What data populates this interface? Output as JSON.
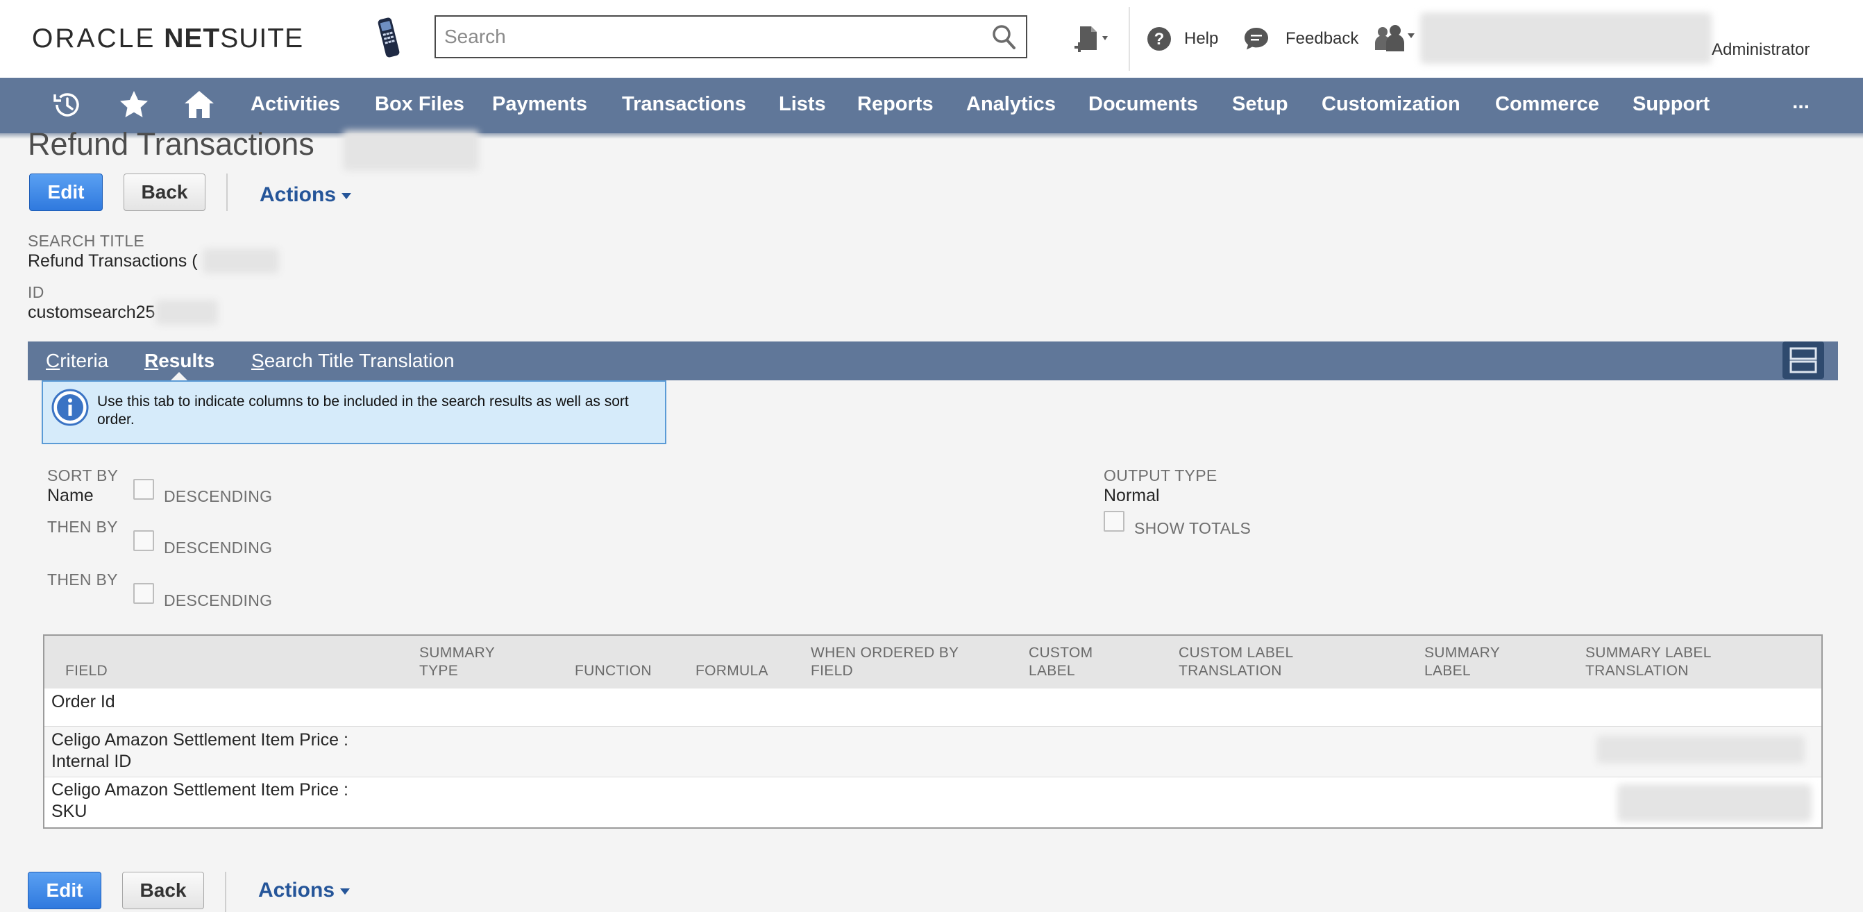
{
  "header": {
    "logo_oracle": "ORACLE",
    "logo_net": "NET",
    "logo_suite": "SUITE",
    "search_placeholder": "Search",
    "help_label": "Help",
    "feedback_label": "Feedback",
    "role_label": "Administrator"
  },
  "nav": {
    "items": [
      "Activities",
      "Box Files",
      "Payments",
      "Transactions",
      "Lists",
      "Reports",
      "Analytics",
      "Documents",
      "Setup",
      "Customization",
      "Commerce",
      "Support"
    ],
    "more": "..."
  },
  "page": {
    "title": "Refund Transactions",
    "buttons": {
      "edit": "Edit",
      "back": "Back",
      "actions": "Actions"
    },
    "search_title_label": "SEARCH TITLE",
    "search_title_value": "Refund Transactions (",
    "id_label": "ID",
    "id_value": "customsearch25"
  },
  "tabs": {
    "criteria_first": "C",
    "criteria_rest": "riteria",
    "results_first": "R",
    "results_rest": "esults",
    "translation_first": "S",
    "translation_rest": "earch Title Translation"
  },
  "info": {
    "text": "Use this tab to indicate columns to be included in the search results as well as sort order."
  },
  "sort": {
    "sort_by_label": "SORT BY",
    "sort_by_value": "Name",
    "then_by_label": "THEN BY",
    "descending_label": "DESCENDING",
    "descending_1": false,
    "descending_2": false,
    "descending_3": false
  },
  "output": {
    "type_label": "OUTPUT TYPE",
    "type_value": "Normal",
    "show_totals_label": "SHOW TOTALS",
    "show_totals": false
  },
  "table": {
    "columns": [
      [
        "FIELD"
      ],
      [
        "SUMMARY",
        "TYPE"
      ],
      [
        "FUNCTION"
      ],
      [
        "FORMULA"
      ],
      [
        "WHEN ORDERED BY",
        "FIELD"
      ],
      [
        "CUSTOM",
        "LABEL"
      ],
      [
        "CUSTOM LABEL",
        "TRANSLATION"
      ],
      [
        "SUMMARY",
        "LABEL"
      ],
      [
        "SUMMARY LABEL",
        "TRANSLATION"
      ]
    ],
    "rows": [
      [
        "Order Id"
      ],
      [
        "Celigo Amazon Settlement Item Price :",
        "Internal ID"
      ],
      [
        "Celigo Amazon Settlement Item Price :",
        "SKU"
      ]
    ]
  },
  "colors": {
    "nav_bg": "#607799",
    "accent_blue": "#2f79de",
    "link_blue": "#255599",
    "info_bg": "#d6ebfa"
  },
  "icons": [
    "phone-icon",
    "search-icon",
    "recent-doc-icon",
    "help-icon",
    "feedback-icon",
    "roles-icon",
    "recent-records-icon",
    "star-icon",
    "home-icon",
    "info-icon",
    "layout-toggle-icon"
  ]
}
